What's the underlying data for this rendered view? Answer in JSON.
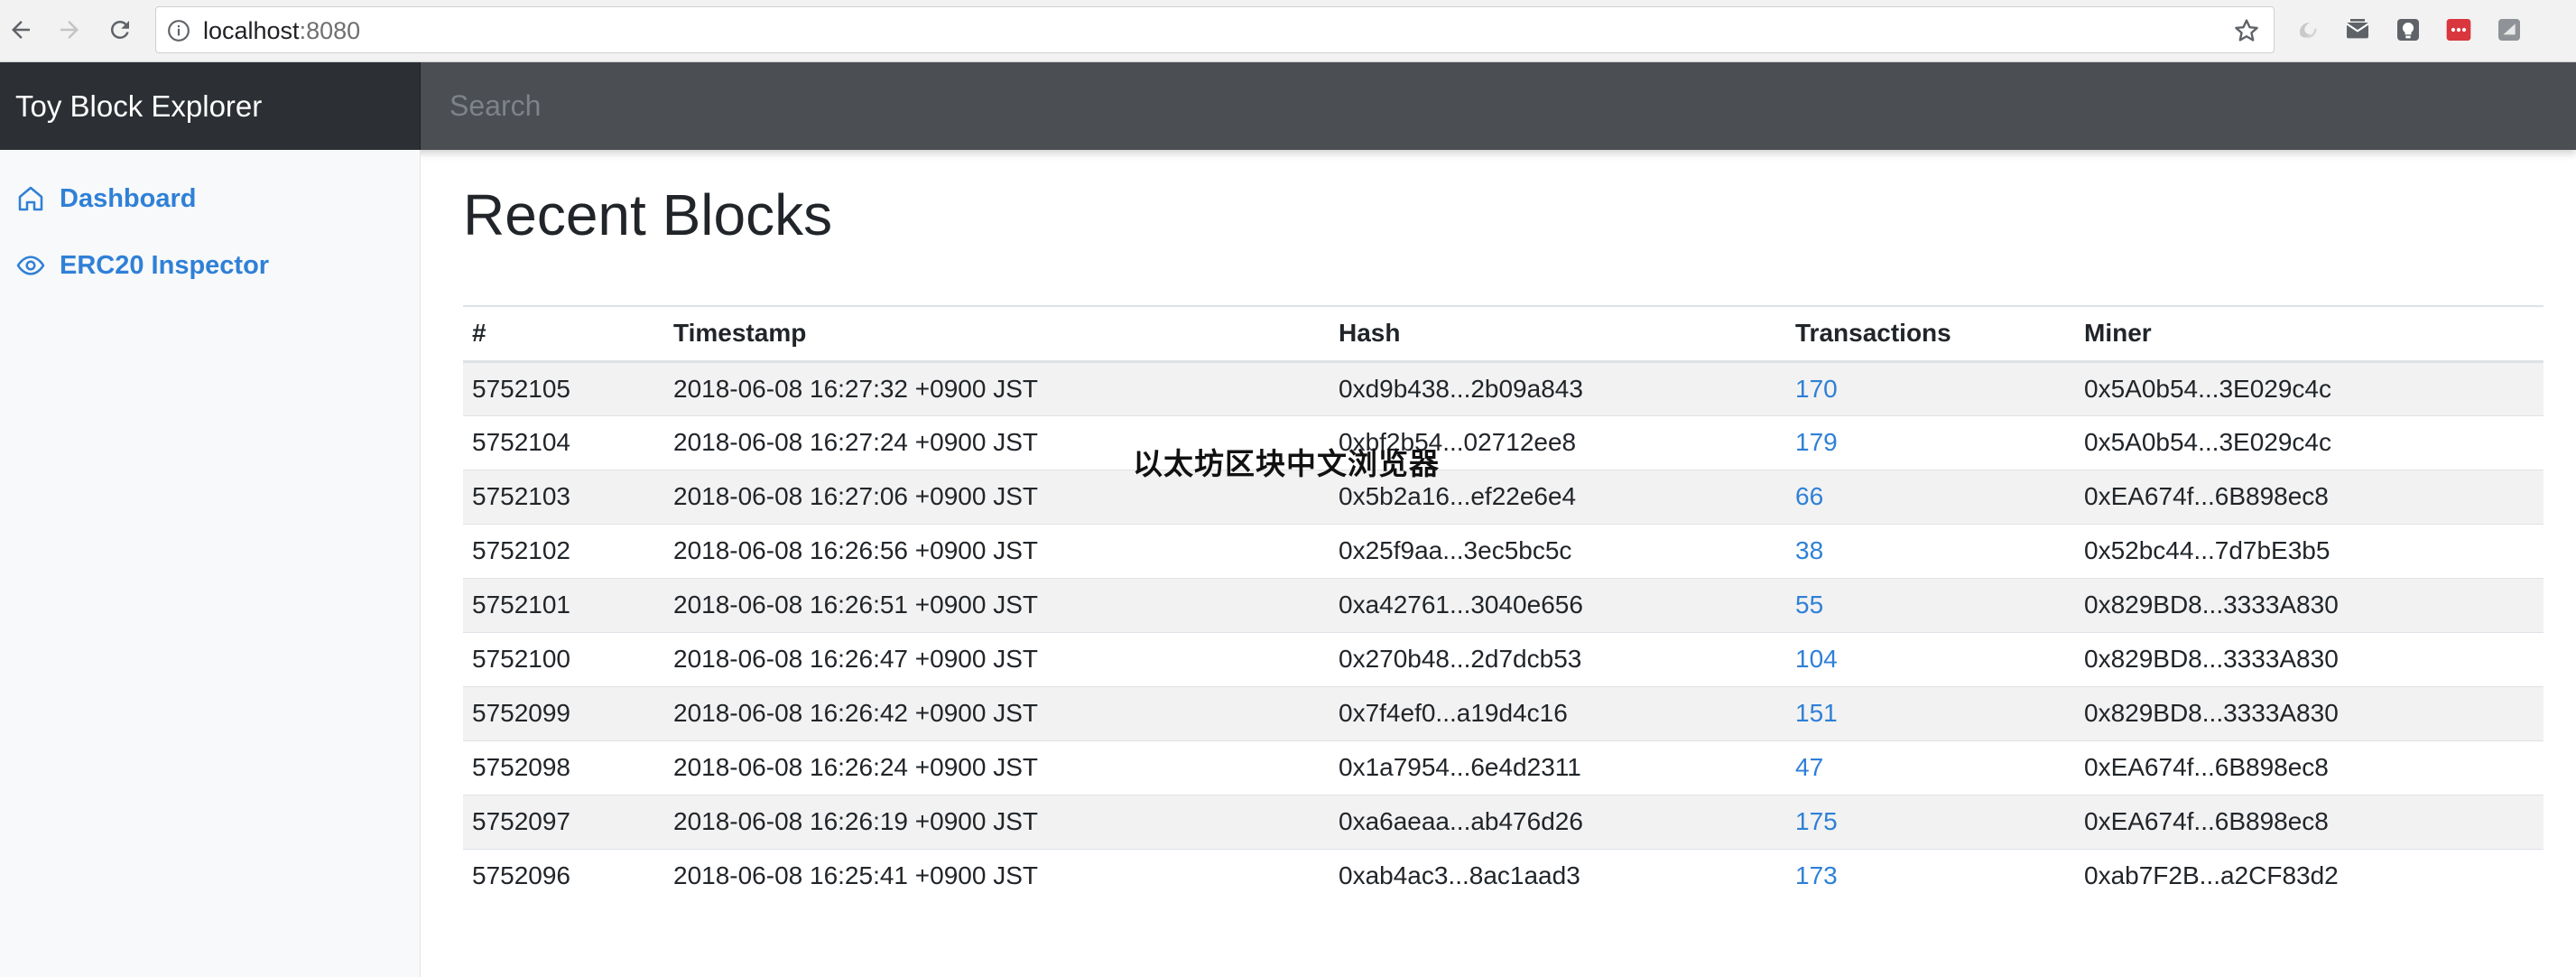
{
  "browser": {
    "url_host": "localhost",
    "url_port": ":8080",
    "back_icon": "arrow-left-icon",
    "forward_icon": "arrow-right-icon",
    "reload_icon": "reload-icon",
    "info_icon": "info-icon",
    "bookmark_icon": "star-icon",
    "extensions": [
      "swirl-extension-icon",
      "envelope-extension-icon",
      "lightbulb-extension-icon",
      "red-menu-extension-icon",
      "gray-square-extension-icon"
    ]
  },
  "header": {
    "brand": "Toy Block Explorer",
    "search_placeholder": "Search"
  },
  "sidebar": {
    "items": [
      {
        "label": "Dashboard",
        "icon": "home-icon"
      },
      {
        "label": "ERC20 Inspector",
        "icon": "eye-icon"
      }
    ]
  },
  "main": {
    "title": "Recent Blocks",
    "table": {
      "headers": [
        "#",
        "Timestamp",
        "Hash",
        "Transactions",
        "Miner"
      ],
      "rows": [
        {
          "number": "5752105",
          "timestamp": "2018-06-08 16:27:32 +0900 JST",
          "hash": "0xd9b438...2b09a843",
          "transactions": "170",
          "miner": "0x5A0b54...3E029c4c"
        },
        {
          "number": "5752104",
          "timestamp": "2018-06-08 16:27:24 +0900 JST",
          "hash": "0xbf2b54...02712ee8",
          "transactions": "179",
          "miner": "0x5A0b54...3E029c4c"
        },
        {
          "number": "5752103",
          "timestamp": "2018-06-08 16:27:06 +0900 JST",
          "hash": "0x5b2a16...ef22e6e4",
          "transactions": "66",
          "miner": "0xEA674f...6B898ec8"
        },
        {
          "number": "5752102",
          "timestamp": "2018-06-08 16:26:56 +0900 JST",
          "hash": "0x25f9aa...3ec5bc5c",
          "transactions": "38",
          "miner": "0x52bc44...7d7bE3b5"
        },
        {
          "number": "5752101",
          "timestamp": "2018-06-08 16:26:51 +0900 JST",
          "hash": "0xa42761...3040e656",
          "transactions": "55",
          "miner": "0x829BD8...3333A830"
        },
        {
          "number": "5752100",
          "timestamp": "2018-06-08 16:26:47 +0900 JST",
          "hash": "0x270b48...2d7dcb53",
          "transactions": "104",
          "miner": "0x829BD8...3333A830"
        },
        {
          "number": "5752099",
          "timestamp": "2018-06-08 16:26:42 +0900 JST",
          "hash": "0x7f4ef0...a19d4c16",
          "transactions": "151",
          "miner": "0x829BD8...3333A830"
        },
        {
          "number": "5752098",
          "timestamp": "2018-06-08 16:26:24 +0900 JST",
          "hash": "0x1a7954...6e4d2311",
          "transactions": "47",
          "miner": "0xEA674f...6B898ec8"
        },
        {
          "number": "5752097",
          "timestamp": "2018-06-08 16:26:19 +0900 JST",
          "hash": "0xa6aeaa...ab476d26",
          "transactions": "175",
          "miner": "0xEA674f...6B898ec8"
        },
        {
          "number": "5752096",
          "timestamp": "2018-06-08 16:25:41 +0900 JST",
          "hash": "0xab4ac3...8ac1aad3",
          "transactions": "173",
          "miner": "0xab7F2B...a2CF83d2"
        }
      ]
    }
  },
  "overlay": {
    "watermark": "以太坊区块中文浏览器"
  },
  "colors": {
    "link": "#2f80d7",
    "brand_bg": "#2c2f33",
    "topbar_bg": "#4b4e52",
    "sidebar_bg": "#f8f9fa",
    "stripe": "#f2f2f2"
  }
}
